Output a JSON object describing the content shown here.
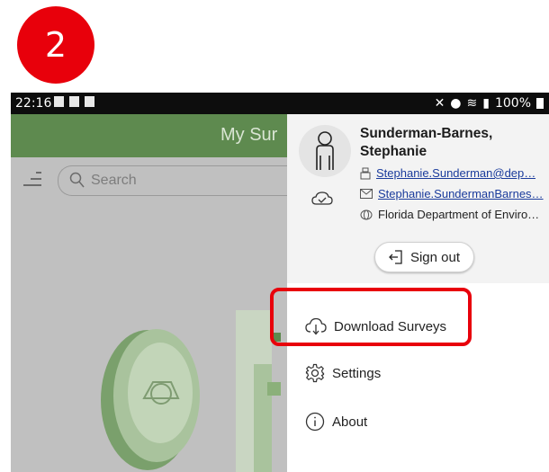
{
  "step_badge": "2",
  "status_bar": {
    "time": "22:16",
    "battery_percent": "100%"
  },
  "app_bar": {
    "title": "My Sur"
  },
  "search": {
    "placeholder": "Search"
  },
  "drawer": {
    "user_name_line1": "Sunderman-Barnes,",
    "user_name_line2": "Stephanie",
    "username": "Stephanie.Sunderman@dep…",
    "email": "Stephanie.SundermanBarnes…",
    "organization": "Florida Department of Enviro…",
    "sign_out_label": "Sign out",
    "items": [
      {
        "label": "Download Surveys",
        "icon": "cloud-download-icon"
      },
      {
        "label": "Settings",
        "icon": "gear-icon"
      },
      {
        "label": "About",
        "icon": "info-icon"
      }
    ]
  },
  "colors": {
    "app_bar": "#5e8a4f",
    "highlight": "#e8000b",
    "link": "#1a3b9c",
    "overlay": "#c0c0c0"
  }
}
